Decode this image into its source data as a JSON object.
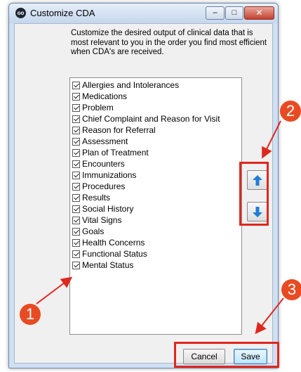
{
  "window": {
    "title": "Customize CDA",
    "close_glyph": "✕",
    "minimize_glyph": "–",
    "maximize_glyph": "□"
  },
  "description": "Customize the desired output of clinical data that is most relevant to you in the order you find most efficient when CDA's are received.",
  "sections": [
    "Allergies and Intolerances",
    "Medications",
    "Problem",
    "Chief Complaint and Reason for Visit",
    "Reason for Referral",
    "Assessment",
    "Plan of Treatment",
    "Encounters",
    "Immunizations",
    "Procedures",
    "Results",
    "Social History",
    "Vital Signs",
    "Goals",
    "Health Concerns",
    "Functional Status",
    "Mental Status"
  ],
  "buttons": {
    "cancel": "Cancel",
    "save": "Save"
  },
  "icons": {
    "move_up": "arrow-up-icon",
    "move_down": "arrow-down-icon"
  },
  "callouts": {
    "one": "1",
    "two": "2",
    "three": "3"
  },
  "colors": {
    "callout": "#e84b23",
    "highlight": "#e0271d",
    "arrow_blue": "#1f7dd6"
  }
}
